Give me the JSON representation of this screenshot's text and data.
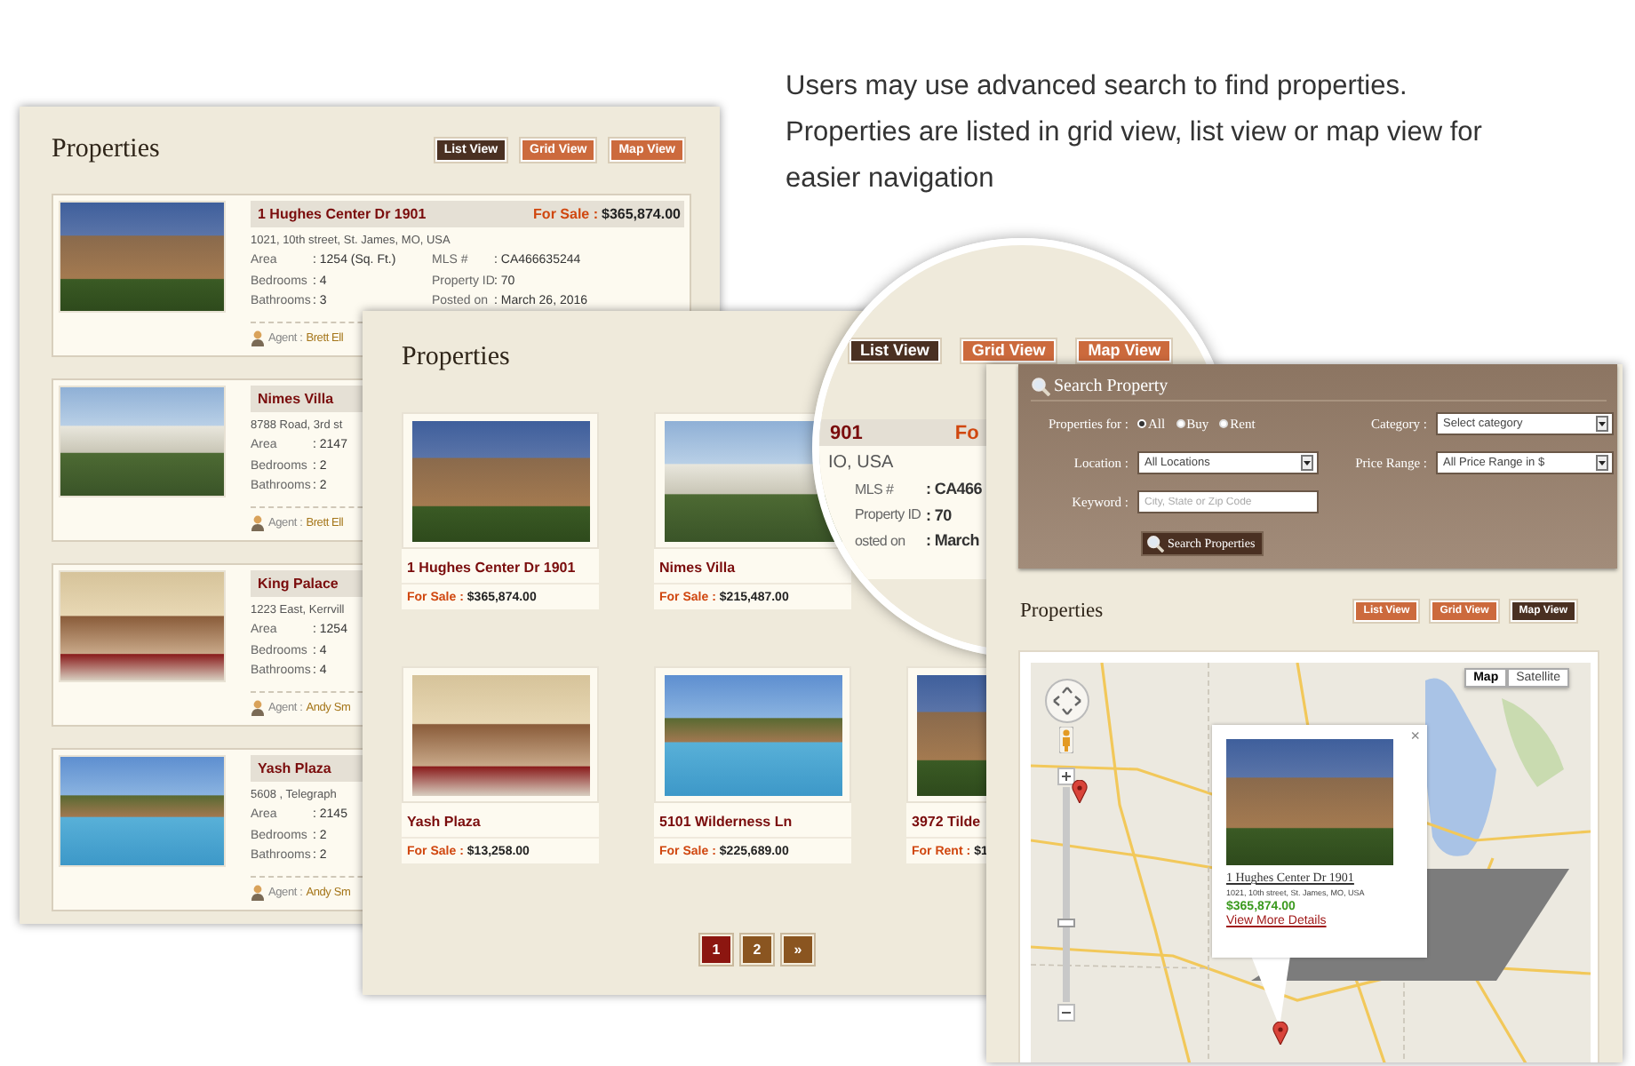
{
  "caption": "Users may use advanced search to find properties. Properties are listed in grid view, list view or map view for easier navigation",
  "list_panel": {
    "title": "Properties",
    "view_buttons": [
      {
        "label": "List View",
        "selected": true
      },
      {
        "label": "Grid View",
        "selected": false
      },
      {
        "label": "Map View",
        "selected": false
      }
    ],
    "listings": [
      {
        "name": "1 Hughes Center Dr 1901",
        "status": "For Sale :",
        "price": "$365,874.00",
        "address": "1021, 10th street, St. James, MO, USA",
        "fields": [
          {
            "label": "Area",
            "value": ": 1254 (Sq. Ft.)"
          },
          {
            "label": "Bedrooms",
            "value": ": 4"
          },
          {
            "label": "Bathrooms",
            "value": ": 3"
          },
          {
            "label": "MLS #",
            "value": ": CA466635244"
          },
          {
            "label": "Property ID",
            "value": ": 70"
          },
          {
            "label": "Posted on",
            "value": ": March 26, 2016"
          }
        ],
        "agent_label": "Agent :",
        "agent": "Brett Ell"
      },
      {
        "name": "Nimes Villa",
        "address": "8788 Road, 3rd st",
        "fields": [
          {
            "label": "Area",
            "value": ": 2147"
          },
          {
            "label": "Bedrooms",
            "value": ": 2"
          },
          {
            "label": "Bathrooms",
            "value": ": 2"
          }
        ],
        "agent_label": "Agent :",
        "agent": "Brett Ell"
      },
      {
        "name": "King Palace",
        "address": "1223 East, Kerrvill",
        "fields": [
          {
            "label": "Area",
            "value": ": 1254"
          },
          {
            "label": "Bedrooms",
            "value": ": 4"
          },
          {
            "label": "Bathrooms",
            "value": ": 4"
          }
        ],
        "agent_label": "Agent :",
        "agent": "Andy Sm"
      },
      {
        "name": "Yash Plaza",
        "address": "5608 , Telegraph",
        "fields": [
          {
            "label": "Area",
            "value": ": 2145"
          },
          {
            "label": "Bedrooms",
            "value": ": 2"
          },
          {
            "label": "Bathrooms",
            "value": ": 2"
          }
        ],
        "agent_label": "Agent :",
        "agent": "Andy Sm"
      }
    ]
  },
  "grid_panel": {
    "title": "Properties",
    "grid_rows": [
      [
        {
          "name": "1 Hughes Center Dr 1901",
          "status": "For Sale :",
          "price": "$365,874.00"
        },
        {
          "name": "Nimes Villa",
          "status": "For Sale :",
          "price": "$215,487.00"
        }
      ],
      [
        {
          "name": "Yash Plaza",
          "status": "For Sale :",
          "price": "$13,258.00"
        },
        {
          "name": "5101 Wilderness Ln",
          "status": "For Sale :",
          "price": "$225,689.00"
        },
        {
          "name": "3972 Tilde",
          "status": "For Rent :",
          "price": "$1"
        }
      ]
    ],
    "pagination": [
      {
        "label": "1",
        "selected": true
      },
      {
        "label": "2",
        "selected": false
      },
      {
        "label": "»",
        "selected": false
      }
    ]
  },
  "magnifier": {
    "view_buttons": [
      {
        "label": "List View",
        "selected": true
      },
      {
        "label": "Grid View",
        "selected": false
      },
      {
        "label": "Map View",
        "selected": false
      }
    ],
    "listing": {
      "name": "901",
      "status": "Fo",
      "address": "IO, USA",
      "fields": [
        {
          "label": "MLS #",
          "value": ": CA466"
        },
        {
          "label": "Property ID",
          "value": ": 70"
        },
        {
          "label": "osted on",
          "value": ": March"
        }
      ]
    }
  },
  "map_panel": {
    "search": {
      "title": "Search Property",
      "properties_for_label": "Properties for :",
      "options": [
        {
          "label": "All",
          "selected": true
        },
        {
          "label": "Buy",
          "selected": false
        },
        {
          "label": "Rent",
          "selected": false
        }
      ],
      "category_label": "Category :",
      "category": "Select category",
      "location_label": "Location :",
      "location": "All Locations",
      "price_range_label": "Price Range :",
      "price_range": "All Price Range in $",
      "keyword_label": "Keyword :",
      "keyword_placeholder": "City, State or Zip Code",
      "button": "Search Properties"
    },
    "title": "Properties",
    "view_buttons": [
      {
        "label": "List View",
        "selected": false
      },
      {
        "label": "Grid View",
        "selected": false
      },
      {
        "label": "Map View",
        "selected": true
      }
    ],
    "map": {
      "map_type_buttons": [
        {
          "label": "Map",
          "selected": true
        },
        {
          "label": "Satellite",
          "selected": false
        }
      ],
      "zoom": {
        "level": 0.35
      },
      "info_window": {
        "close": "×",
        "title": "1 Hughes Center Dr 1901",
        "address": "1021, 10th street, St. James, MO, USA",
        "price": "$365,874.00",
        "link": "View More Details"
      }
    }
  }
}
